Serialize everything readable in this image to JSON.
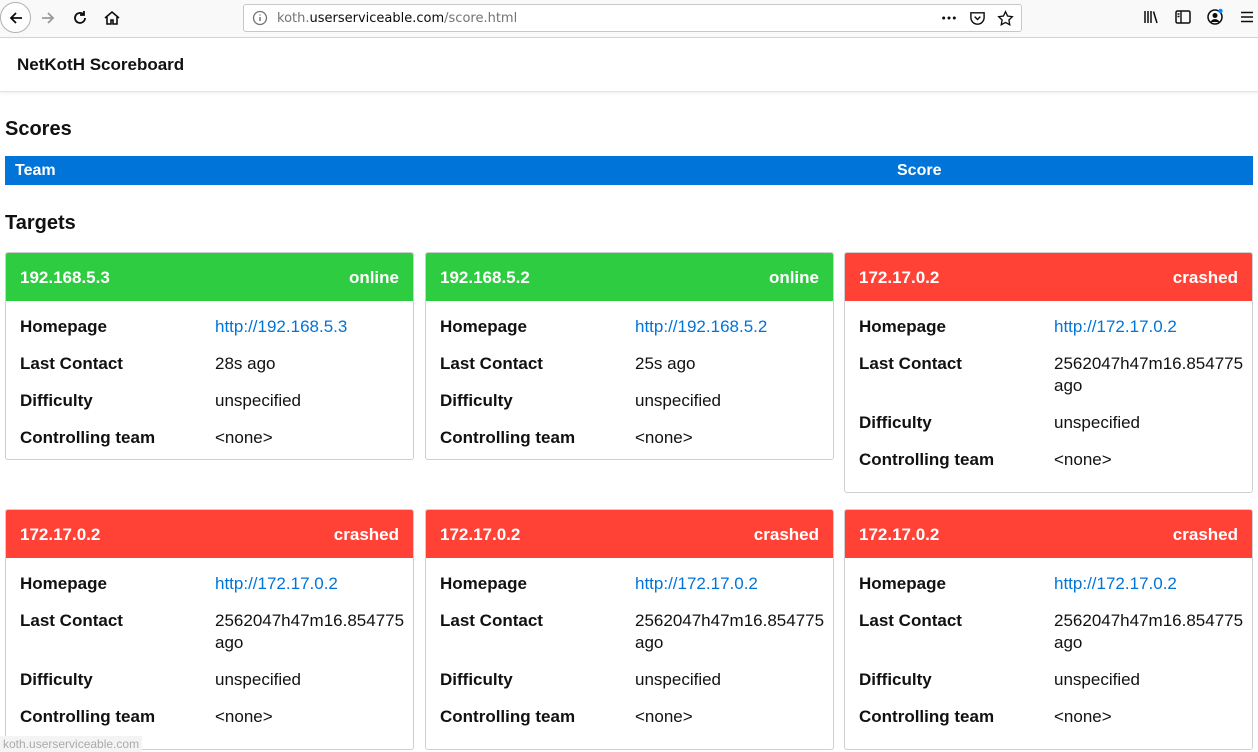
{
  "browser": {
    "url_prefix": "koth.",
    "url_host": "userserviceable.com",
    "url_path": "/score.html",
    "icons": [
      "back-icon",
      "forward-icon",
      "reload-icon",
      "home-icon",
      "info-icon",
      "more-icon",
      "pocket-icon",
      "bookmark-star-icon",
      "library-icon",
      "sidebar-icon",
      "account-icon",
      "menu-icon"
    ]
  },
  "navbar": {
    "brand": "NetKotH Scoreboard"
  },
  "scores": {
    "title": "Scores",
    "columns": [
      "Team",
      "Score"
    ]
  },
  "targets": {
    "title": "Targets",
    "labels": {
      "homepage": "Homepage",
      "last_contact": "Last Contact",
      "difficulty": "Difficulty",
      "controlling_team": "Controlling team"
    },
    "cards": [
      {
        "ip": "192.168.5.3",
        "status": "online",
        "homepage": "http://192.168.5.3",
        "last_contact": "28s ago",
        "difficulty": "unspecified",
        "controlling_team": "<none>"
      },
      {
        "ip": "192.168.5.2",
        "status": "online",
        "homepage": "http://192.168.5.2",
        "last_contact": "25s ago",
        "difficulty": "unspecified",
        "controlling_team": "<none>"
      },
      {
        "ip": "172.17.0.2",
        "status": "crashed",
        "homepage": "http://172.17.0.2",
        "last_contact": "2562047h47m16.854775\nago",
        "difficulty": "unspecified",
        "controlling_team": "<none>"
      },
      {
        "ip": "172.17.0.2",
        "status": "crashed",
        "homepage": "http://172.17.0.2",
        "last_contact": "2562047h47m16.854775\nago",
        "difficulty": "unspecified",
        "controlling_team": "<none>"
      },
      {
        "ip": "172.17.0.2",
        "status": "crashed",
        "homepage": "http://172.17.0.2",
        "last_contact": "2562047h47m16.854775\nago",
        "difficulty": "unspecified",
        "controlling_team": "<none>"
      },
      {
        "ip": "172.17.0.2",
        "status": "crashed",
        "homepage": "http://172.17.0.2",
        "last_contact": "2562047h47m16.854775\nago",
        "difficulty": "unspecified",
        "controlling_team": "<none>"
      }
    ]
  },
  "status_bar": {
    "text": "koth.userserviceable.com"
  },
  "colors": {
    "header_blue": "#0074d9",
    "online": "#2ecc40",
    "crashed": "#ff4136",
    "link": "#0074d9"
  }
}
